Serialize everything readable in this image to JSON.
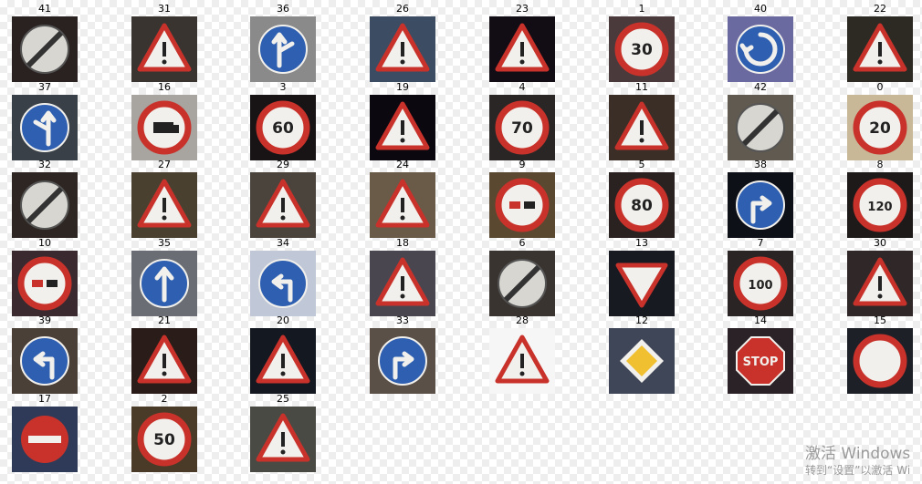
{
  "grid": {
    "items": [
      {
        "label": "41",
        "sign": "end-no-overtaking",
        "bg": "#2a2220"
      },
      {
        "label": "31",
        "sign": "warning-triangle-wild-animals",
        "bg": "#3a3430"
      },
      {
        "label": "36",
        "sign": "straight-or-right",
        "bg": "#8a8a8a"
      },
      {
        "label": "26",
        "sign": "warning-triangle-traffic-signals",
        "bg": "#3b4c63"
      },
      {
        "label": "23",
        "sign": "warning-triangle-slippery-road",
        "bg": "#120d14"
      },
      {
        "label": "1",
        "sign": "speed-limit-30",
        "bg": "#4a3a3c"
      },
      {
        "label": "40",
        "sign": "roundabout-mandatory",
        "bg": "#6a6aa0"
      },
      {
        "label": "22",
        "sign": "warning-triangle-bumpy-road",
        "bg": "#2d2a24"
      },
      {
        "label": "37",
        "sign": "straight-or-left",
        "bg": "#3a4048"
      },
      {
        "label": "16",
        "sign": "no-trucks",
        "bg": "#a8a4a0"
      },
      {
        "label": "3",
        "sign": "speed-limit-60",
        "bg": "#181416"
      },
      {
        "label": "19",
        "sign": "warning-triangle-curve-left",
        "bg": "#0b0810"
      },
      {
        "label": "4",
        "sign": "speed-limit-70",
        "bg": "#2a2626"
      },
      {
        "label": "11",
        "sign": "warning-triangle-right-of-way",
        "bg": "#3a2e26"
      },
      {
        "label": "42",
        "sign": "end-no-overtaking-trucks",
        "bg": "#605a50"
      },
      {
        "label": "0",
        "sign": "speed-limit-20",
        "bg": "#c8b898"
      },
      {
        "label": "32",
        "sign": "end-all-limits",
        "bg": "#2e2622"
      },
      {
        "label": "27",
        "sign": "warning-triangle-pedestrians",
        "bg": "#4a4030"
      },
      {
        "label": "29",
        "sign": "warning-triangle-bicycles",
        "bg": "#4a443c"
      },
      {
        "label": "24",
        "sign": "warning-triangle-road-narrows",
        "bg": "#6a5a48"
      },
      {
        "label": "9",
        "sign": "no-overtaking",
        "bg": "#5a4830"
      },
      {
        "label": "5",
        "sign": "speed-limit-80",
        "bg": "#2a2220"
      },
      {
        "label": "38",
        "sign": "keep-right",
        "bg": "#0e1018"
      },
      {
        "label": "8",
        "sign": "speed-limit-120",
        "bg": "#1e1a1a"
      },
      {
        "label": "10",
        "sign": "no-overtaking-trucks",
        "bg": "#3a2a30"
      },
      {
        "label": "35",
        "sign": "ahead-only",
        "bg": "#6a6e74"
      },
      {
        "label": "34",
        "sign": "turn-left-ahead",
        "bg": "#c0c8d8"
      },
      {
        "label": "18",
        "sign": "warning-triangle-general-caution",
        "bg": "#4a4650"
      },
      {
        "label": "6",
        "sign": "end-speed-limit-80",
        "bg": "#3a3430"
      },
      {
        "label": "13",
        "sign": "yield",
        "bg": "#181a22"
      },
      {
        "label": "7",
        "sign": "speed-limit-100",
        "bg": "#2a2424"
      },
      {
        "label": "30",
        "sign": "warning-triangle-snow",
        "bg": "#302828"
      },
      {
        "label": "39",
        "sign": "keep-left",
        "bg": "#4a4038"
      },
      {
        "label": "21",
        "sign": "warning-triangle-double-curve",
        "bg": "#2a1c18"
      },
      {
        "label": "20",
        "sign": "warning-triangle-curve-right",
        "bg": "#141820"
      },
      {
        "label": "33",
        "sign": "turn-right-ahead",
        "bg": "#5a5048"
      },
      {
        "label": "28",
        "sign": "warning-triangle-children",
        "bg": "#f6f6f6"
      },
      {
        "label": "12",
        "sign": "priority-road",
        "bg": "#3e4658"
      },
      {
        "label": "14",
        "sign": "stop",
        "bg": "#2a2226"
      },
      {
        "label": "15",
        "sign": "no-vehicles",
        "bg": "#1e2028"
      },
      {
        "label": "17",
        "sign": "no-entry",
        "bg": "#2e3a58"
      },
      {
        "label": "2",
        "sign": "speed-limit-50",
        "bg": "#4a3a28"
      },
      {
        "label": "25",
        "sign": "warning-triangle-road-work",
        "bg": "#4a4a44"
      }
    ]
  },
  "sign_text": {
    "speed-limit-20": "20",
    "speed-limit-30": "30",
    "speed-limit-50": "50",
    "speed-limit-60": "60",
    "speed-limit-70": "70",
    "speed-limit-80": "80",
    "speed-limit-100": "100",
    "speed-limit-120": "120",
    "stop": "STOP"
  },
  "colors": {
    "sign_red": "#c8322a",
    "sign_blue": "#2e5fb0",
    "sign_white": "#f2f0ec",
    "sign_yellow": "#f0c030"
  },
  "watermark": {
    "title": "激活 Windows",
    "subtitle": "转到“设置”以激活 Wi"
  }
}
